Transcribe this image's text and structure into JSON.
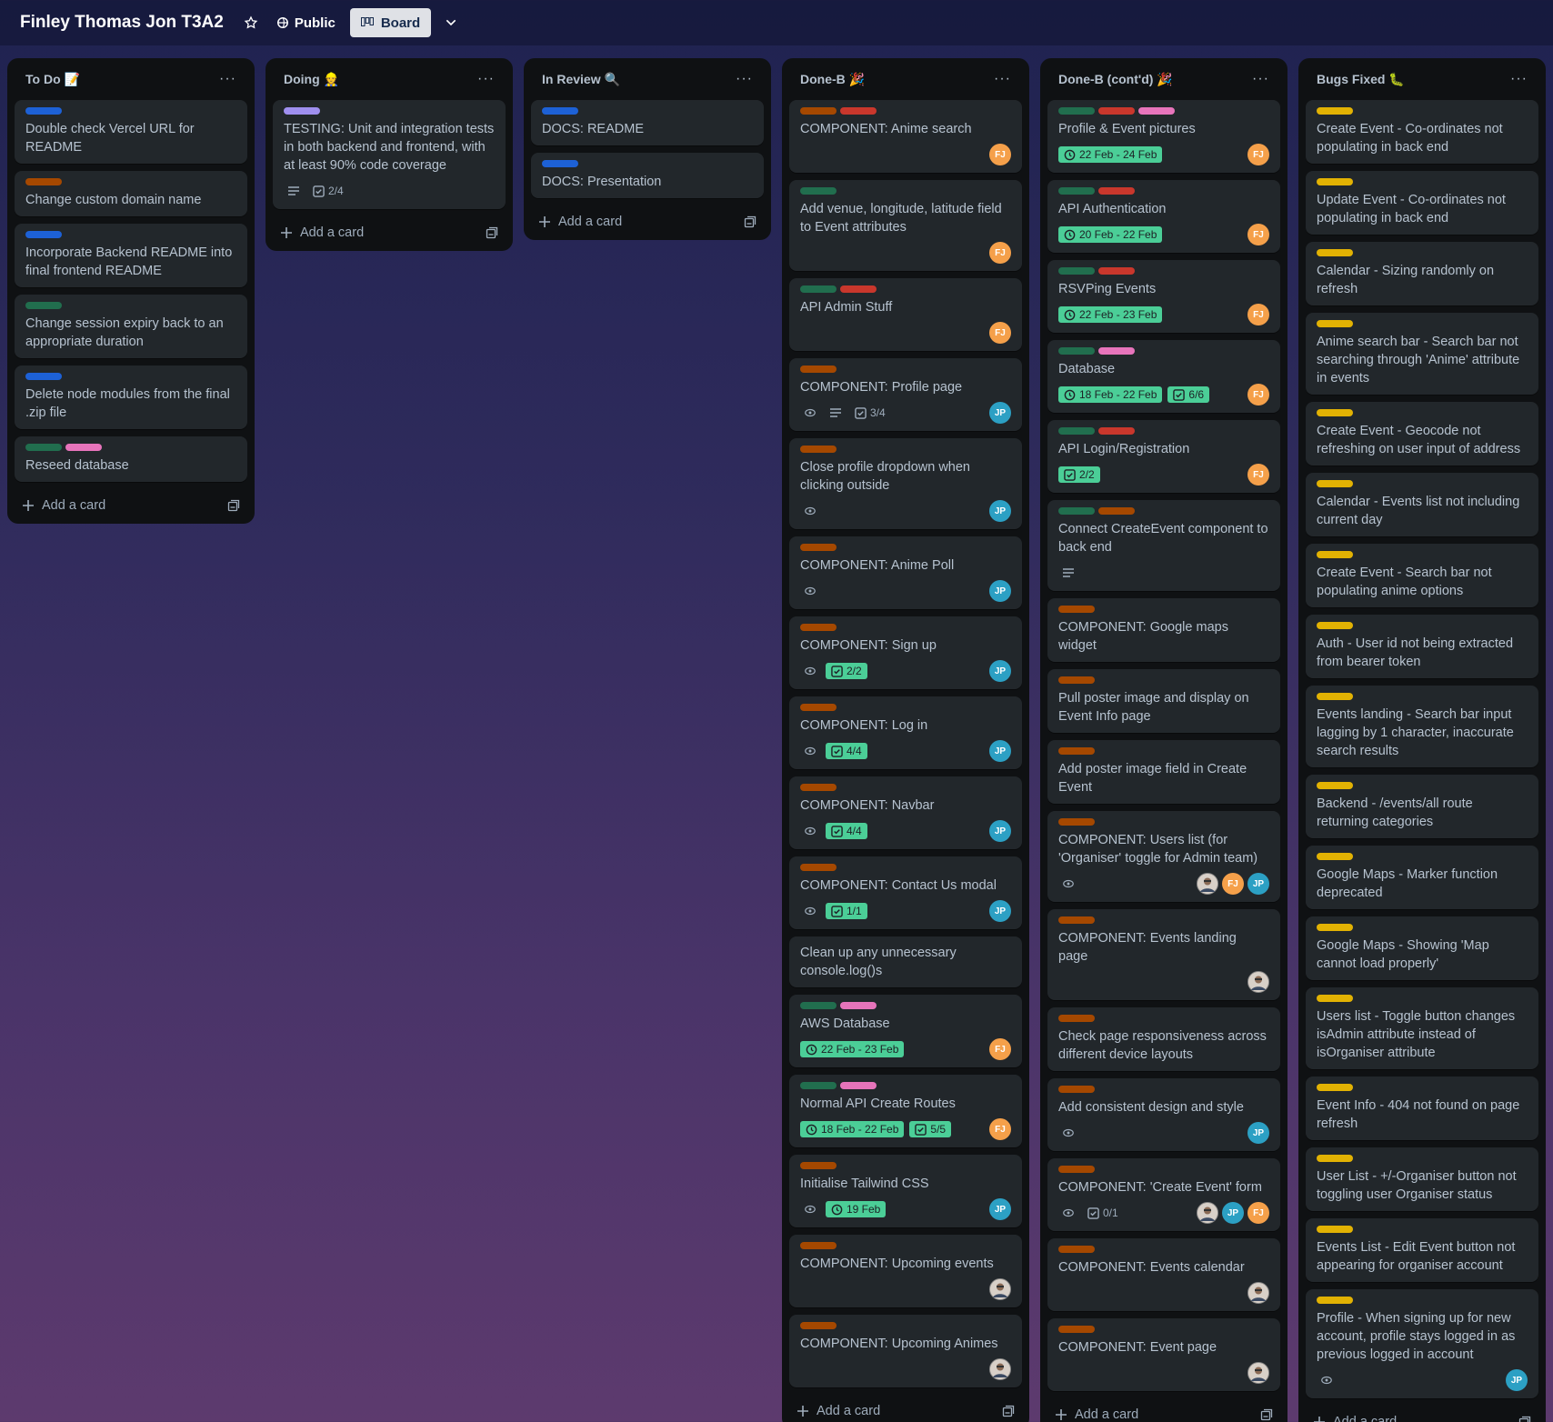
{
  "board": {
    "title": "Finley Thomas Jon T3A2",
    "visibility": "Public",
    "view": "Board"
  },
  "colors": {
    "green": "#4bce97",
    "label_blue": "#1d61d6",
    "label_orange": "#a54800",
    "label_red": "#c9372c",
    "label_green": "#216e4e",
    "label_pink": "#e774bb",
    "label_purple": "#9f8fef",
    "label_yellow": "#e2b203"
  },
  "add_card_label": "Add a card",
  "lists": [
    {
      "title": "To Do 📝",
      "cards": [
        {
          "labels": [
            "blue"
          ],
          "title": "Double check Vercel URL for README"
        },
        {
          "labels": [
            "orange"
          ],
          "title": "Change custom domain name"
        },
        {
          "labels": [
            "blue"
          ],
          "title": "Incorporate Backend README into final frontend README"
        },
        {
          "labels": [
            "green"
          ],
          "title": "Change session expiry back to an appropriate duration"
        },
        {
          "labels": [
            "blue"
          ],
          "title": "Delete node modules from the final .zip file"
        },
        {
          "labels": [
            "green",
            "pink"
          ],
          "title": "Reseed database"
        }
      ]
    },
    {
      "title": "Doing 👷",
      "cards": [
        {
          "labels": [
            "purple"
          ],
          "title": "TESTING: Unit and integration tests in both backend and frontend, with at least 90% code coverage",
          "desc": true,
          "check": "2/4"
        }
      ]
    },
    {
      "title": "In Review 🔍",
      "cards": [
        {
          "labels": [
            "blue"
          ],
          "title": "DOCS: README"
        },
        {
          "labels": [
            "blue"
          ],
          "title": "DOCS: Presentation"
        }
      ]
    },
    {
      "title": "Done-B 🎉",
      "cards": [
        {
          "labels": [
            "orange",
            "red"
          ],
          "title": "COMPONENT: Anime search",
          "members": [
            "FJ"
          ]
        },
        {
          "labels": [
            "green"
          ],
          "title": "Add venue, longitude, latitude field to Event attributes",
          "members": [
            "FJ"
          ]
        },
        {
          "labels": [
            "green",
            "red"
          ],
          "title": "API Admin Stuff",
          "members": [
            "FJ"
          ]
        },
        {
          "labels": [
            "orange"
          ],
          "title": "COMPONENT: Profile page",
          "watch": true,
          "desc": true,
          "check": "3/4",
          "members": [
            "JP"
          ]
        },
        {
          "labels": [
            "orange"
          ],
          "title": "Close profile dropdown when clicking outside",
          "watch": true,
          "members": [
            "JP"
          ]
        },
        {
          "labels": [
            "orange"
          ],
          "title": "COMPONENT: Anime Poll",
          "watch": true,
          "members": [
            "JP"
          ]
        },
        {
          "labels": [
            "orange"
          ],
          "title": "COMPONENT: Sign up",
          "watch": true,
          "check_done": "2/2",
          "members": [
            "JP"
          ]
        },
        {
          "labels": [
            "orange"
          ],
          "title": "COMPONENT: Log in",
          "watch": true,
          "check_done": "4/4",
          "members": [
            "JP"
          ]
        },
        {
          "labels": [
            "orange"
          ],
          "title": "COMPONENT: Navbar",
          "watch": true,
          "check_done": "4/4",
          "members": [
            "JP"
          ]
        },
        {
          "labels": [
            "orange"
          ],
          "title": "COMPONENT: Contact Us modal",
          "watch": true,
          "check_done": "1/1",
          "members": [
            "JP"
          ]
        },
        {
          "labels": [],
          "title": "Clean up any unnecessary console.log()s"
        },
        {
          "labels": [
            "green",
            "pink"
          ],
          "title": "AWS Database",
          "date": "22 Feb - 23 Feb",
          "members": [
            "FJ"
          ]
        },
        {
          "labels": [
            "green",
            "pink"
          ],
          "title": "Normal API Create Routes",
          "date": "18 Feb - 22 Feb",
          "check_done": "5/5",
          "members": [
            "FJ"
          ]
        },
        {
          "labels": [
            "orange"
          ],
          "title": "Initialise Tailwind CSS",
          "watch": true,
          "date": "19 Feb",
          "members": [
            "JP"
          ]
        },
        {
          "labels": [
            "orange"
          ],
          "title": "COMPONENT: Upcoming events",
          "members": [
            "PH"
          ]
        },
        {
          "labels": [
            "orange"
          ],
          "title": "COMPONENT: Upcoming Animes",
          "members": [
            "PH"
          ]
        }
      ]
    },
    {
      "title": "Done-B (cont'd) 🎉",
      "cards": [
        {
          "labels": [
            "green",
            "red",
            "pink"
          ],
          "title": "Profile & Event pictures",
          "date": "22 Feb - 24 Feb",
          "members": [
            "FJ"
          ]
        },
        {
          "labels": [
            "green",
            "red"
          ],
          "title": "API Authentication",
          "date": "20 Feb - 22 Feb",
          "members": [
            "FJ"
          ]
        },
        {
          "labels": [
            "green",
            "red"
          ],
          "title": "RSVPing Events",
          "date": "22 Feb - 23 Feb",
          "members": [
            "FJ"
          ]
        },
        {
          "labels": [
            "green",
            "pink"
          ],
          "title": "Database",
          "date": "18 Feb - 22 Feb",
          "check_done": "6/6",
          "members": [
            "FJ"
          ]
        },
        {
          "labels": [
            "green",
            "red"
          ],
          "title": "API Login/Registration",
          "check_done": "2/2",
          "members": [
            "FJ"
          ]
        },
        {
          "labels": [
            "green",
            "orange"
          ],
          "title": "Connect CreateEvent component to back end",
          "desc": true
        },
        {
          "labels": [
            "orange"
          ],
          "title": "COMPONENT: Google maps widget"
        },
        {
          "labels": [
            "orange"
          ],
          "title": "Pull poster image and display on Event Info page"
        },
        {
          "labels": [
            "orange"
          ],
          "title": "Add poster image field in Create Event"
        },
        {
          "labels": [
            "orange"
          ],
          "title": "COMPONENT: Users list (for 'Organiser' toggle for Admin team)",
          "watch": true,
          "members": [
            "PH",
            "FJ",
            "JP"
          ]
        },
        {
          "labels": [
            "orange"
          ],
          "title": "COMPONENT: Events landing page",
          "members": [
            "PH"
          ]
        },
        {
          "labels": [
            "orange"
          ],
          "title": "Check page responsiveness across different device layouts"
        },
        {
          "labels": [
            "orange"
          ],
          "title": "Add consistent design and style",
          "watch": true,
          "members": [
            "JP"
          ]
        },
        {
          "labels": [
            "orange"
          ],
          "title": "COMPONENT: 'Create Event' form",
          "watch": true,
          "check": "0/1",
          "members": [
            "PH",
            "JP",
            "FJ"
          ]
        },
        {
          "labels": [
            "orange"
          ],
          "title": "COMPONENT: Events calendar",
          "members": [
            "PH"
          ]
        },
        {
          "labels": [
            "orange"
          ],
          "title": "COMPONENT: Event page",
          "members": [
            "PH"
          ]
        }
      ]
    },
    {
      "title": "Bugs Fixed 🐛",
      "cards": [
        {
          "labels": [
            "yellow"
          ],
          "title": "Create Event - Co-ordinates not populating in back end"
        },
        {
          "labels": [
            "yellow"
          ],
          "title": "Update Event - Co-ordinates not populating in back end"
        },
        {
          "labels": [
            "yellow"
          ],
          "title": "Calendar - Sizing randomly on refresh"
        },
        {
          "labels": [
            "yellow"
          ],
          "title": "Anime search bar - Search bar not searching through 'Anime' attribute in events"
        },
        {
          "labels": [
            "yellow"
          ],
          "title": "Create Event - Geocode not refreshing on user input of address"
        },
        {
          "labels": [
            "yellow"
          ],
          "title": "Calendar - Events list not including current day"
        },
        {
          "labels": [
            "yellow"
          ],
          "title": "Create Event - Search bar not populating anime options"
        },
        {
          "labels": [
            "yellow"
          ],
          "title": "Auth - User id not being extracted from bearer token"
        },
        {
          "labels": [
            "yellow"
          ],
          "title": "Events landing - Search bar input lagging by 1 character, inaccurate search results"
        },
        {
          "labels": [
            "yellow"
          ],
          "title": "Backend - /events/all route returning categories"
        },
        {
          "labels": [
            "yellow"
          ],
          "title": "Google Maps - Marker function deprecated"
        },
        {
          "labels": [
            "yellow"
          ],
          "title": "Google Maps - Showing 'Map cannot load properly'"
        },
        {
          "labels": [
            "yellow"
          ],
          "title": "Users list - Toggle button changes isAdmin attribute instead of isOrganiser attribute"
        },
        {
          "labels": [
            "yellow"
          ],
          "title": "Event Info - 404 not found on page refresh"
        },
        {
          "labels": [
            "yellow"
          ],
          "title": "User List - +/-Organiser button not toggling user Organiser status"
        },
        {
          "labels": [
            "yellow"
          ],
          "title": "Events List - Edit Event button not appearing for organiser account"
        },
        {
          "labels": [
            "yellow"
          ],
          "title": "Profile - When signing up for new account, profile stays logged in as previous logged in account",
          "watch": true,
          "members": [
            "JP"
          ]
        }
      ]
    }
  ]
}
